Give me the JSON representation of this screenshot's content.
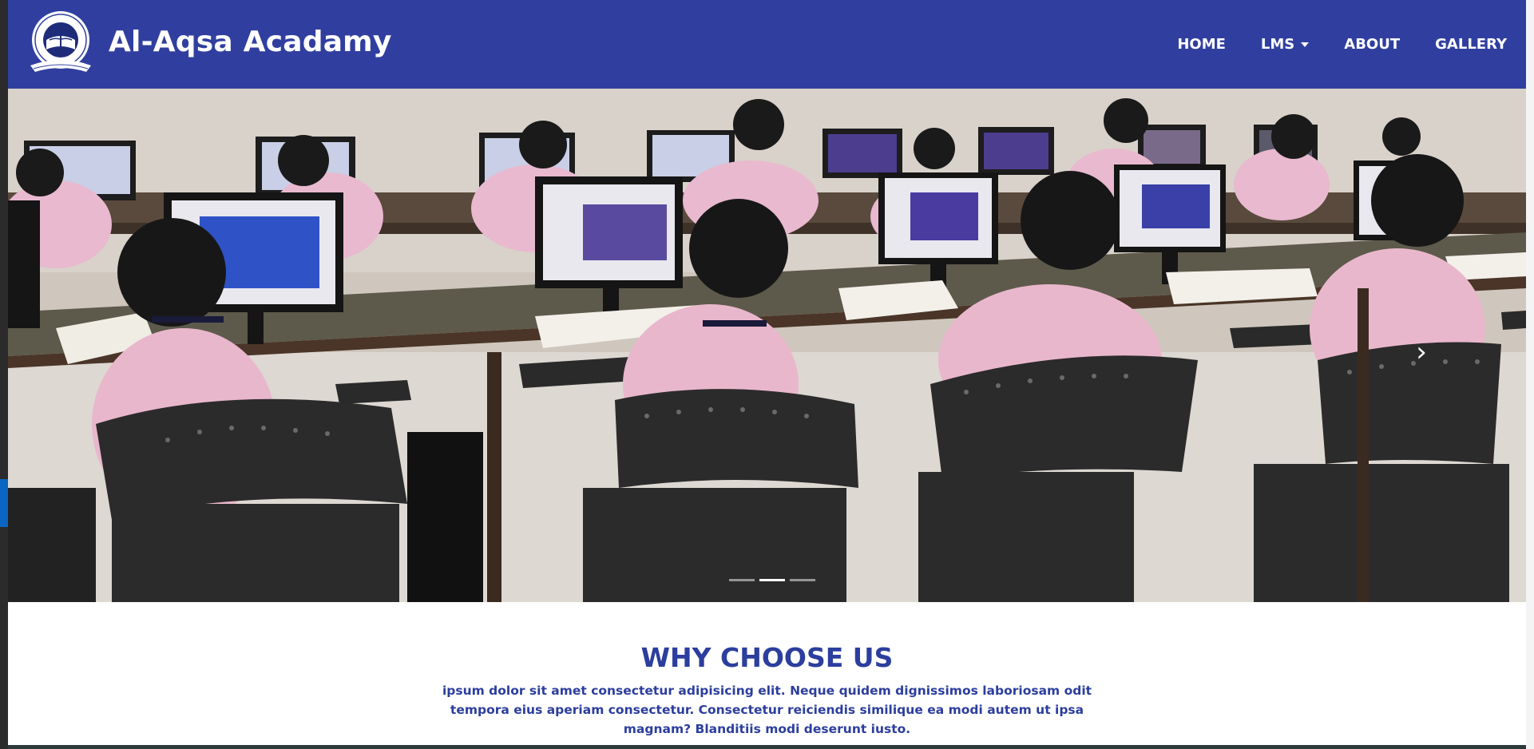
{
  "navbar": {
    "brand_name": "Al-Aqsa Acadamy",
    "logo_icon": "book-globe-logo",
    "items": [
      {
        "label": "HOME"
      },
      {
        "label": "LMS",
        "has_dropdown": true
      },
      {
        "label": "ABOUT"
      },
      {
        "label": "GALLERY"
      }
    ],
    "background_color": "#303f9f"
  },
  "carousel": {
    "image": "computer-lab-students-photo",
    "next_icon": "chevron-right-icon",
    "slide_count": 3,
    "active_slide": 2
  },
  "why_section": {
    "title": "WHY CHOOSE US",
    "text": "ipsum dolor sit amet consectetur adipisicing elit. Neque quidem dignissimos laboriosam odit tempora eius aperiam consectetur. Consectetur reiciendis similique ea modi autem ut ipsa magnam? Blanditiis modi deserunt iusto.",
    "text_color": "#2c3e9e"
  }
}
